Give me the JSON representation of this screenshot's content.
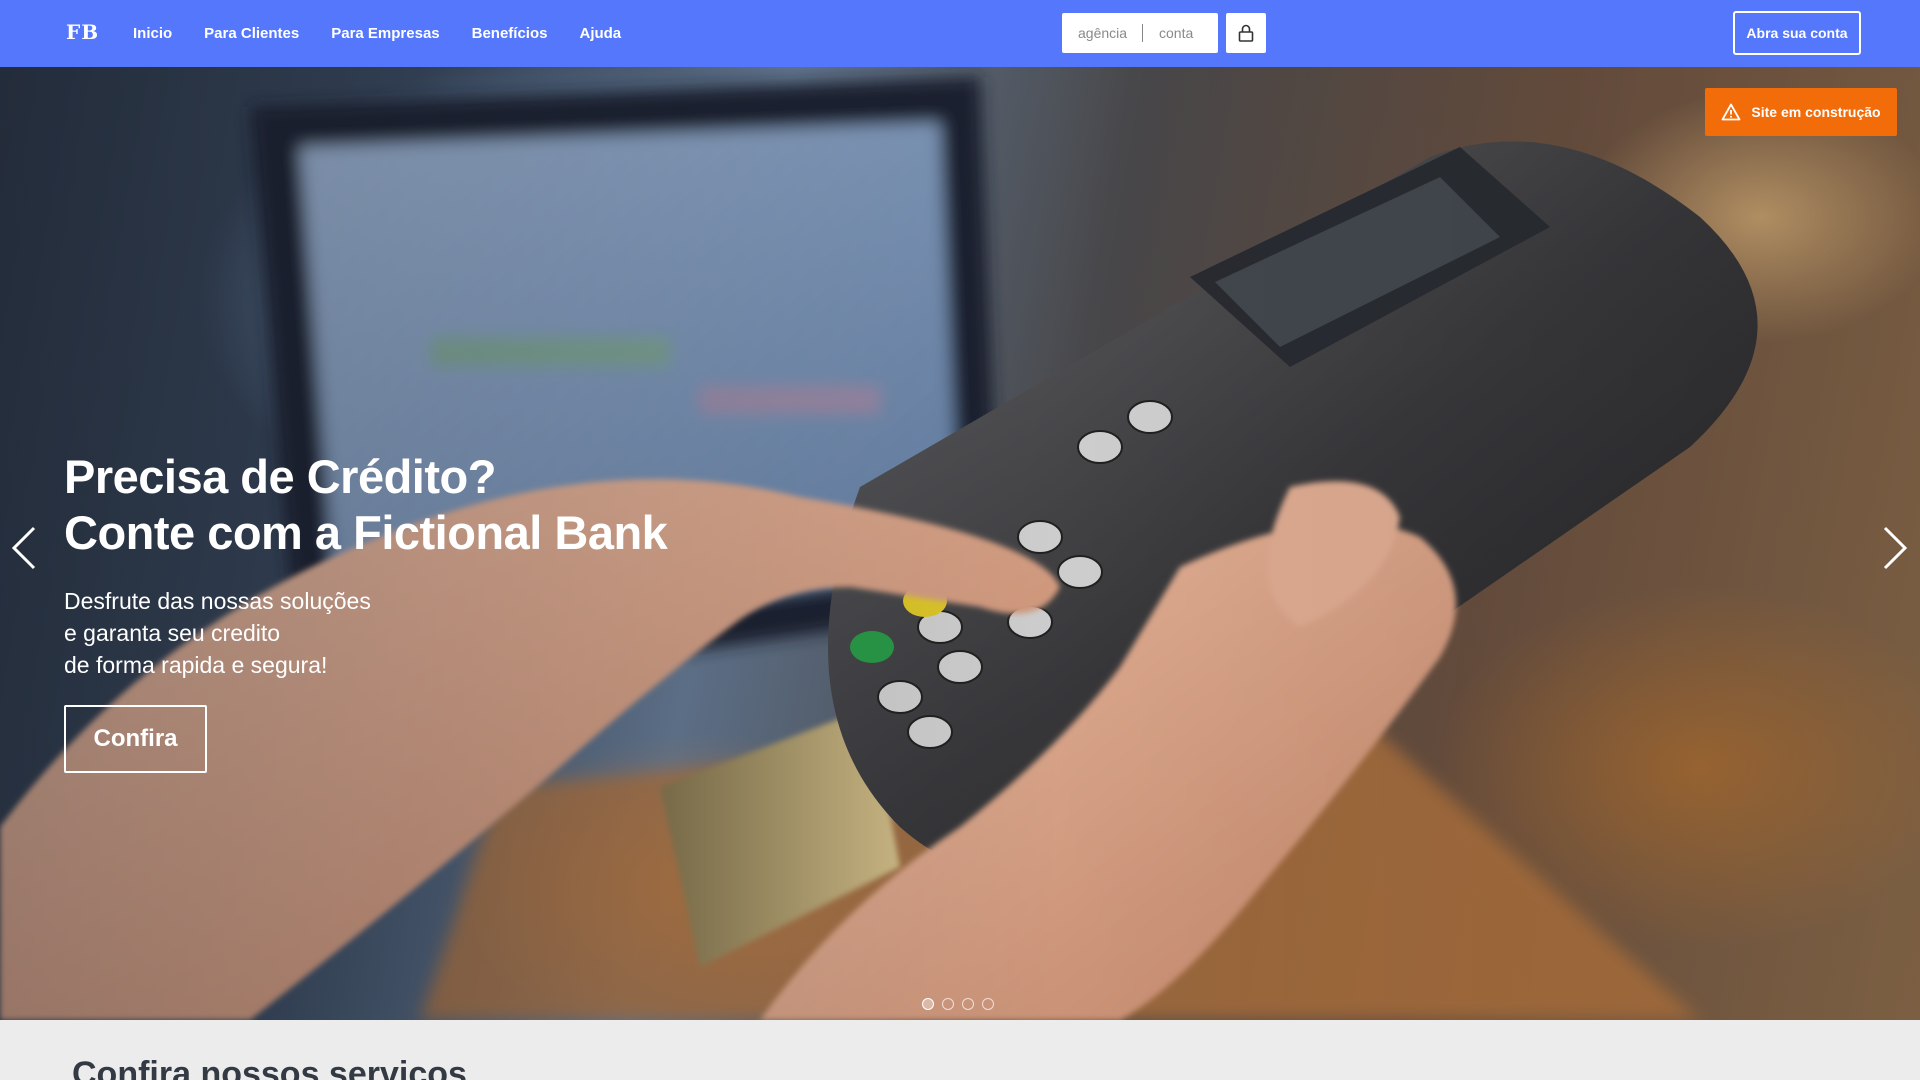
{
  "header": {
    "logo": "FB",
    "nav": [
      "Inicio",
      "Para Clientes",
      "Para Empresas",
      "Benefícios",
      "Ajuda"
    ],
    "login": {
      "agencia_placeholder": "agência",
      "conta_placeholder": "conta"
    },
    "open_account_label": "Abra sua conta",
    "brand_color": "#5577fb"
  },
  "hero": {
    "badge_label": "Site em construção",
    "badge_color": "#f36c0a",
    "title_lines": [
      "Precisa de Crédito?",
      "Conte com a Fictional Bank"
    ],
    "text_lines": [
      "Desfrute das nossas soluções",
      "e garanta seu credito",
      "de forma rapida e segura!"
    ],
    "cta_label": "Confira",
    "slide_count": 4,
    "active_slide": 1
  },
  "services": {
    "heading": "Confira nossos serviços"
  }
}
